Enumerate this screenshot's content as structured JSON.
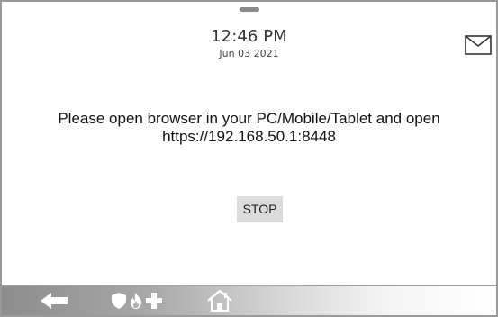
{
  "header": {
    "time": "12:46 PM",
    "date": "Jun 03 2021",
    "icons": {
      "pull_handle": "pull-down-handle",
      "messages": "envelope-icon"
    }
  },
  "main": {
    "message_line1": "Please open browser in your PC/Mobile/Tablet and open",
    "message_line2": "https://192.168.50.1:8448",
    "stop_label": "STOP"
  },
  "bottom_bar": {
    "icons": [
      "back-arrow-icon",
      "shield-icon",
      "fire-icon",
      "medical-cross-icon",
      "home-icon"
    ]
  },
  "colors": {
    "text": "#111111",
    "button_bg": "#dcdcdc",
    "bar_dark": "#8c8c8c",
    "icon_white": "#ffffff"
  }
}
